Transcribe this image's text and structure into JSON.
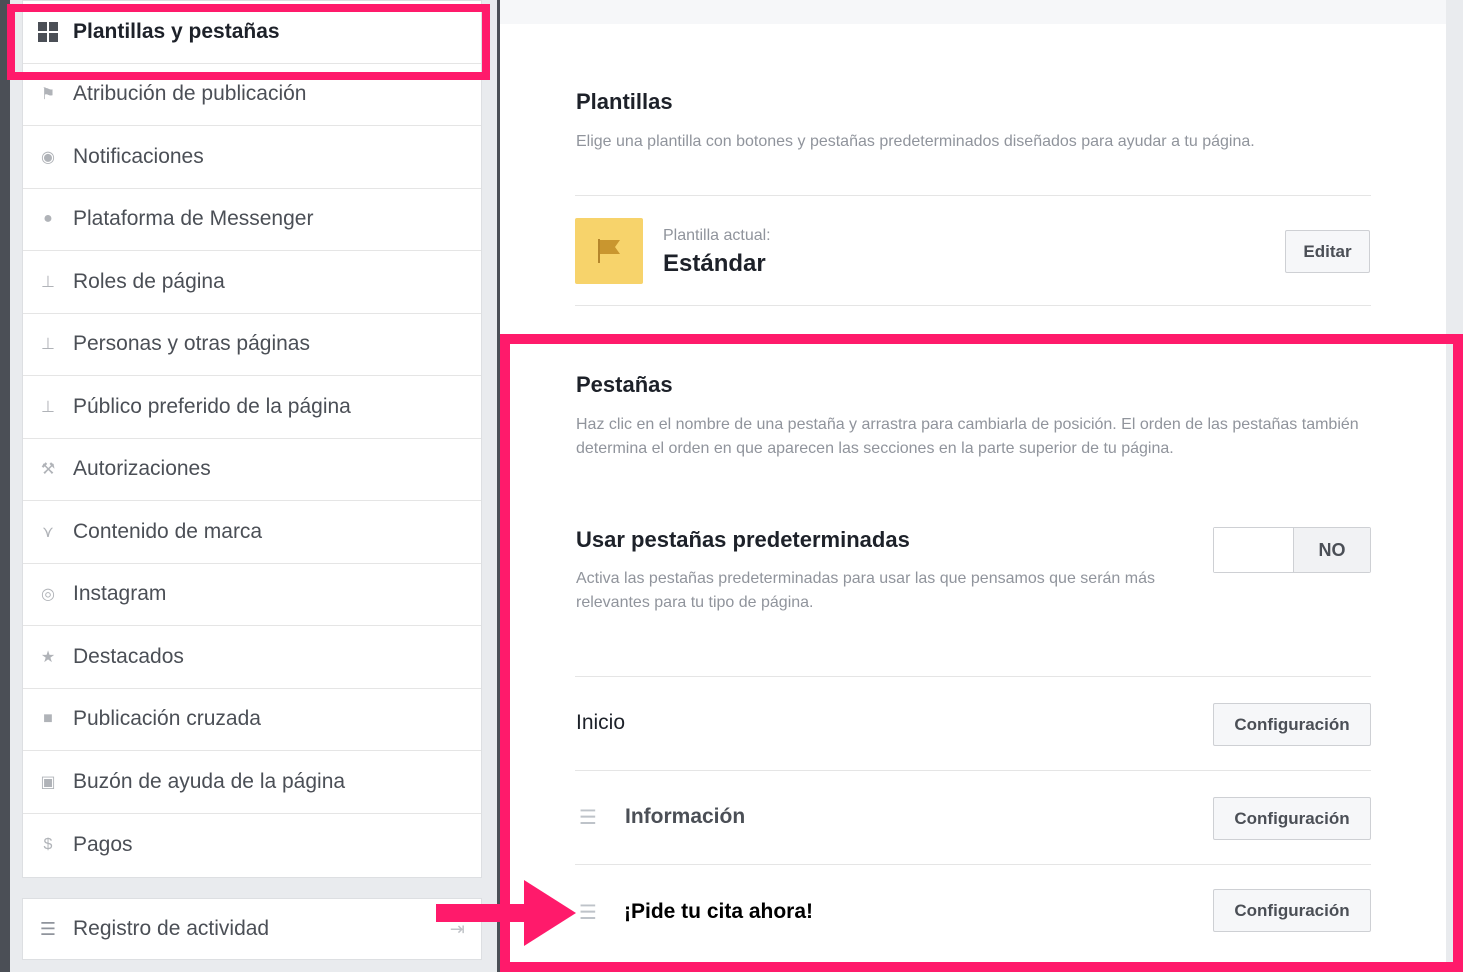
{
  "sidebar": {
    "items": [
      {
        "label": "Plantillas y pestañas",
        "icon": "grid-icon"
      },
      {
        "label": "Atribución de publicación",
        "icon": "flag-icon"
      },
      {
        "label": "Notificaciones",
        "icon": "globe-icon"
      },
      {
        "label": "Plataforma de Messenger",
        "icon": "messenger-icon"
      },
      {
        "label": "Roles de página",
        "icon": "person-icon"
      },
      {
        "label": "Personas y otras páginas",
        "icon": "people-icon"
      },
      {
        "label": "Público preferido de la página",
        "icon": "audience-icon"
      },
      {
        "label": "Autorizaciones",
        "icon": "wrench-icon"
      },
      {
        "label": "Contenido de marca",
        "icon": "handshake-icon"
      },
      {
        "label": "Instagram",
        "icon": "instagram-icon"
      },
      {
        "label": "Destacados",
        "icon": "star-icon"
      },
      {
        "label": "Publicación cruzada",
        "icon": "video-icon"
      },
      {
        "label": "Buzón de ayuda de la página",
        "icon": "inbox-icon"
      },
      {
        "label": "Pagos",
        "icon": "dollar-icon"
      }
    ],
    "activity_log": {
      "label": "Registro de actividad",
      "icon": "list-icon"
    }
  },
  "templates": {
    "title": "Plantillas",
    "description": "Elige una plantilla con botones y pestañas predeterminados diseñados para ayudar a tu página.",
    "current_label": "Plantilla actual:",
    "current_value": "Estándar",
    "edit_label": "Editar"
  },
  "tabs_section": {
    "title": "Pestañas",
    "description": "Haz clic en el nombre de una pestaña y arrastra para cambiarla de posición. El orden de las pestañas también determina el orden en que aparecen las secciones en la parte superior de tu página.",
    "default_tabs_title": "Usar pestañas predeterminadas",
    "default_tabs_desc": "Activa las pestañas predeterminadas para usar las que pensamos que serán más relevantes para tu tipo de página.",
    "toggle_state": "NO",
    "rows": [
      {
        "label": "Inicio",
        "button": "Configuración"
      },
      {
        "label": "Información",
        "button": "Configuración"
      },
      {
        "label": "¡Pide tu cita ahora!",
        "button": "Configuración"
      }
    ]
  },
  "colors": {
    "highlight": "#ff1a6b",
    "flag_bg": "#f7d36b"
  }
}
